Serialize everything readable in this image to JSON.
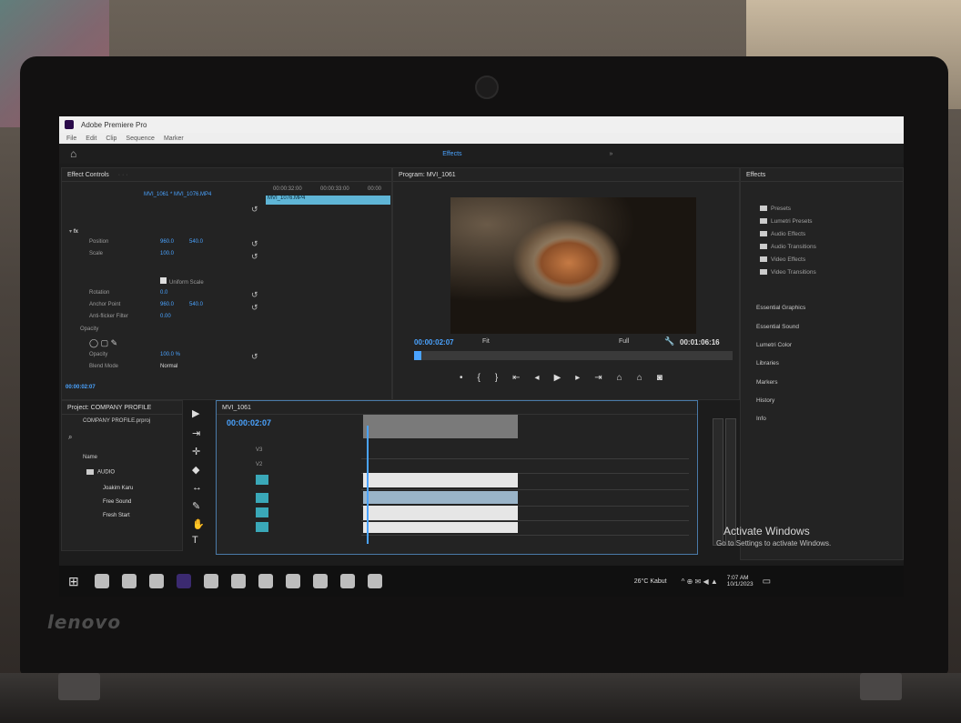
{
  "app": {
    "window_title": "Adobe Premiere Pro",
    "menus": [
      "File",
      "Edit",
      "Clip",
      "Sequence",
      "Marker"
    ],
    "workspace_active": "Effects"
  },
  "effect_controls": {
    "tab_label": "Effect Controls",
    "clip_ref": "MVI_1061 * MVI_1076.MP4",
    "ruler_times": [
      "00:00:32:00",
      "00:00:33:00",
      "00:00"
    ],
    "clip_name": "MVI_1076.MP4",
    "rows": [
      {
        "label": "Position",
        "v1": "960.0",
        "v2": "540.0"
      },
      {
        "label": "Scale",
        "v1": "100.0",
        "v2": ""
      },
      {
        "label": "Uniform Scale",
        "v1": "",
        "v2": ""
      },
      {
        "label": "Rotation",
        "v1": "0.0",
        "v2": ""
      },
      {
        "label": "Anchor Point",
        "v1": "960.0",
        "v2": "540.0"
      },
      {
        "label": "Anti-flicker Filter",
        "v1": "0.00",
        "v2": ""
      },
      {
        "label": "Opacity",
        "v1": "",
        "v2": ""
      },
      {
        "label": "Opacity",
        "v1": "100.0 %",
        "v2": ""
      },
      {
        "label": "Blend Mode",
        "v1": "Normal",
        "v2": ""
      }
    ],
    "timecode": "00:00:02:07"
  },
  "program": {
    "tab_label": "Program: MVI_1061",
    "timecode": "00:00:02:07",
    "fit": "Fit",
    "quality": "Full",
    "duration": "00:01:06:16"
  },
  "effects_panel": {
    "tab_label": "Effects",
    "folders": [
      "Presets",
      "Lumetri Presets",
      "Audio Effects",
      "Audio Transitions",
      "Video Effects",
      "Video Transitions"
    ],
    "sections": [
      "Essential Graphics",
      "Essential Sound",
      "Lumetri Color",
      "Libraries",
      "Markers",
      "History",
      "Info"
    ]
  },
  "project": {
    "tab_label": "Project: COMPANY PROFILE",
    "file_name": "COMPANY PROFILE.prproj",
    "column_name": "Name",
    "items": [
      "AUDIO",
      "Joakim Karu",
      "Free Sound",
      "Fresh Start"
    ]
  },
  "timeline": {
    "tab_label": "MVI_1061",
    "timecode": "00:00:02:07",
    "tracks": [
      "V3",
      "V2",
      "V1",
      "A1",
      "A2",
      "A3"
    ]
  },
  "watermark": {
    "title": "Activate Windows",
    "subtitle": "Go to Settings to activate Windows."
  },
  "taskbar": {
    "weather": "26°C  Kabut",
    "time": "7:07 AM",
    "date": "10/1/2023"
  },
  "hardware": {
    "brand": "lenovo"
  }
}
